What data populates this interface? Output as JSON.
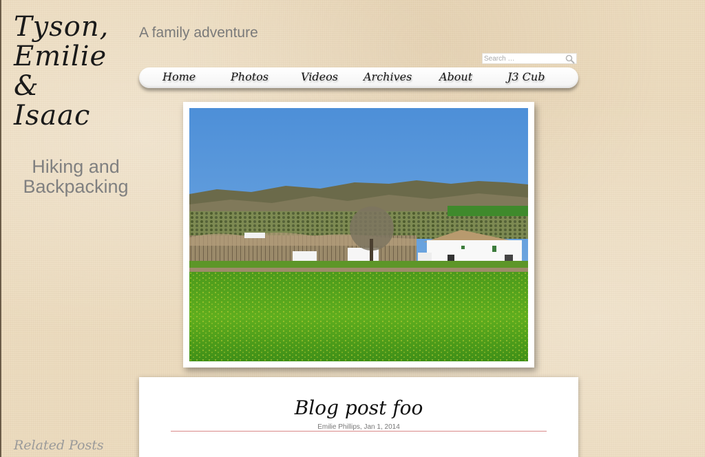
{
  "site": {
    "title_lines": [
      "Tyson,",
      "Emilie &",
      "Isaac"
    ],
    "tagline": "A family adventure"
  },
  "search": {
    "placeholder": "Search …",
    "icon": "magnifier-icon"
  },
  "nav": {
    "items": [
      {
        "label": "Home"
      },
      {
        "label": "Photos"
      },
      {
        "label": "Videos"
      },
      {
        "label": "Archives"
      },
      {
        "label": "About"
      },
      {
        "label": "J3 Cub"
      }
    ]
  },
  "sidebar": {
    "category_heading_lines": [
      "Hiking and",
      "Backpacking"
    ],
    "related_heading": "Related Posts"
  },
  "featured_image": {
    "description": "landscape photo"
  },
  "post": {
    "title": "Blog post foo",
    "author": "Emilie Phillips",
    "date": "Jan 1, 2014",
    "divider_color": "#d98888"
  },
  "colors": {
    "page_background": "#ecdcc0",
    "nav_background": "#ffffff",
    "tagline": "#7a7a7a",
    "sidebar_heading": "#808080"
  }
}
